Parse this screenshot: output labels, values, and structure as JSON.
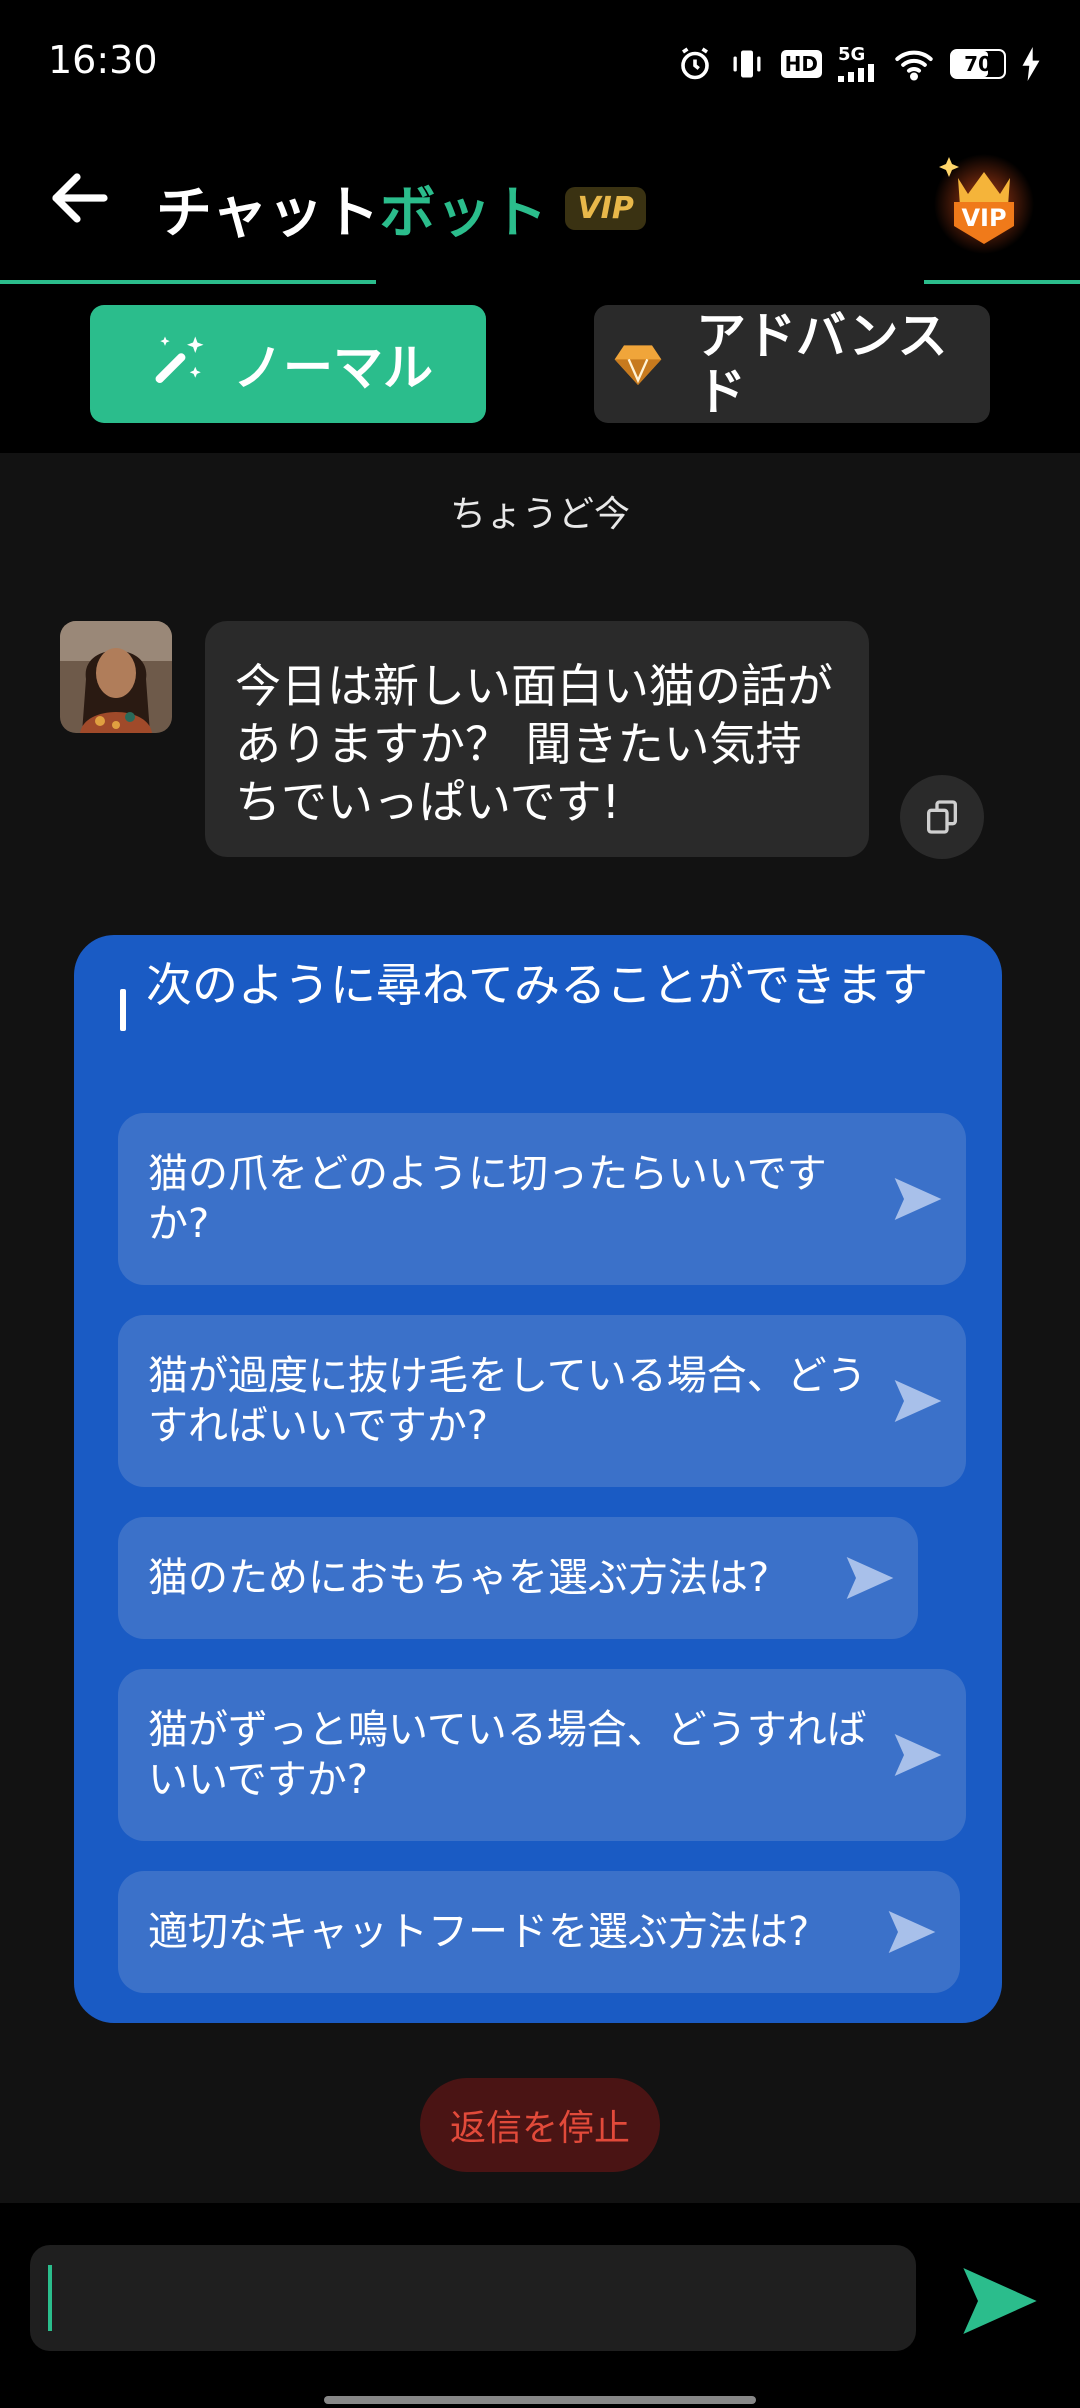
{
  "status_bar": {
    "time": "16:30",
    "hd_label": "HD",
    "network_label": "5G",
    "battery_percent": "70",
    "battery_level": 0.7
  },
  "header": {
    "title_part1": "チャット",
    "title_part2": "ボット",
    "vip_label": "VIP",
    "vip_badge_label": "VIP",
    "accent_color": "#2bbd8c"
  },
  "modes": {
    "normal_label": "ノーマル",
    "advanced_label": "アドバンスド",
    "selected": "normal"
  },
  "chat": {
    "timestamp": "ちょうど今",
    "bot_message": "今日は新しい面白い猫の話がありますか？ 聞きたい気持ちでいっぱいです!"
  },
  "suggestions": {
    "title": "次のように尋ねてみることができます",
    "items": [
      "猫の爪をどのように切ったらいいですか?",
      "猫が過度に抜け毛をしている場合、どうすればいいですか?",
      "猫のためにおもちゃを選ぶ方法は?",
      "猫がずっと鳴いている場合、どうすればいいですか?",
      "適切なキャットフードを選ぶ方法は?"
    ]
  },
  "stop_button_label": "返信を停止",
  "input": {
    "value": "",
    "placeholder": ""
  },
  "icons": {
    "back": "arrow-left-icon",
    "wand": "magic-wand-icon",
    "diamond": "diamond-icon",
    "copy": "copy-icon",
    "send": "send-icon"
  }
}
